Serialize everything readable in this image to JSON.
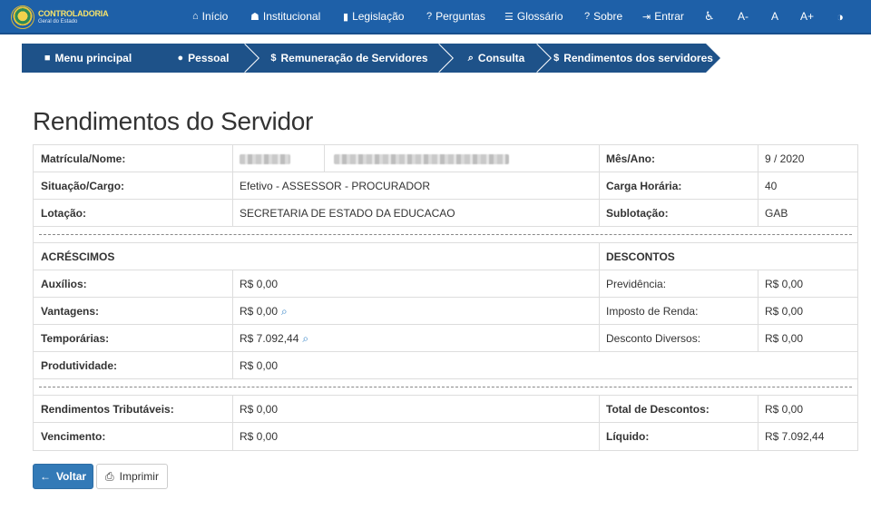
{
  "brand": {
    "title": "CONTROLADORIA",
    "subtitle": "Geral do Estado"
  },
  "nav": {
    "items": [
      {
        "icon": "home-icon",
        "glyph": "⌂",
        "label": "Início"
      },
      {
        "icon": "bank-icon",
        "glyph": "☗",
        "label": "Institucional"
      },
      {
        "icon": "book-icon",
        "glyph": "▮",
        "label": "Legislação"
      },
      {
        "icon": "question-icon",
        "glyph": "?",
        "label": "Perguntas"
      },
      {
        "icon": "list-icon",
        "glyph": "☰",
        "label": "Glossário"
      },
      {
        "icon": "question-icon",
        "glyph": "?",
        "label": "Sobre"
      },
      {
        "icon": "sign-in-icon",
        "glyph": "⇥",
        "label": "Entrar"
      }
    ],
    "accessibility": {
      "wheelchair_glyph": "♿",
      "font_decrease": "A-",
      "font_normal": "A",
      "font_increase": "A+",
      "contrast_glyph": "◑"
    }
  },
  "breadcrumb": [
    {
      "icon": "folder-open-icon",
      "glyph": "■",
      "label": "Menu principal"
    },
    {
      "icon": "users-icon",
      "glyph": "●",
      "label": "Pessoal"
    },
    {
      "icon": "dollar-icon",
      "glyph": "$",
      "label": "Remuneração de Servidores"
    },
    {
      "icon": "search-icon",
      "glyph": "⌕",
      "label": "Consulta"
    },
    {
      "icon": "dollar-icon",
      "glyph": "$",
      "label": "Rendimentos dos servidores"
    }
  ],
  "page_title": "Rendimentos do Servidor",
  "info": {
    "matricula_label": "Matrícula/Nome:",
    "mes_ano_label": "Mês/Ano:",
    "mes_ano_value": "9 / 2020",
    "situacao_label": "Situação/Cargo:",
    "situacao_value": "Efetivo - ASSESSOR - PROCURADOR",
    "carga_label": "Carga Horária:",
    "carga_value": "40",
    "lotacao_label": "Lotação:",
    "lotacao_value": "SECRETARIA DE ESTADO DA EDUCACAO",
    "sublotacao_label": "Sublotação:",
    "sublotacao_value": "GAB"
  },
  "acrescimos": {
    "header": "ACRÉSCIMOS",
    "auxilios_label": "Auxílios:",
    "auxilios_value": "R$ 0,00",
    "vantagens_label": "Vantagens:",
    "vantagens_value": "R$ 0,00",
    "temporarias_label": "Temporárias:",
    "temporarias_value": "R$ 7.092,44",
    "produtividade_label": "Produtividade:",
    "produtividade_value": "R$ 0,00"
  },
  "descontos": {
    "header": "DESCONTOS",
    "previdencia_label": "Previdência:",
    "previdencia_value": "R$ 0,00",
    "ir_label": "Imposto de Renda:",
    "ir_value": "R$ 0,00",
    "diversos_label": "Desconto Diversos:",
    "diversos_value": "R$ 0,00"
  },
  "totais": {
    "tributaveis_label": "Rendimentos Tributáveis:",
    "tributaveis_value": "R$ 0,00",
    "total_desc_label": "Total de Descontos:",
    "total_desc_value": "R$ 0,00",
    "vencimento_label": "Vencimento:",
    "vencimento_value": "R$ 0,00",
    "liquido_label": "Líquido:",
    "liquido_value": "R$ 7.092,44"
  },
  "buttons": {
    "back": "Voltar",
    "print": "Imprimir"
  },
  "colors": {
    "navbar": "#1e60a8",
    "breadcrumb": "#1e5289",
    "primary_button": "#337ab7",
    "search_icon": "#3a86c8"
  }
}
